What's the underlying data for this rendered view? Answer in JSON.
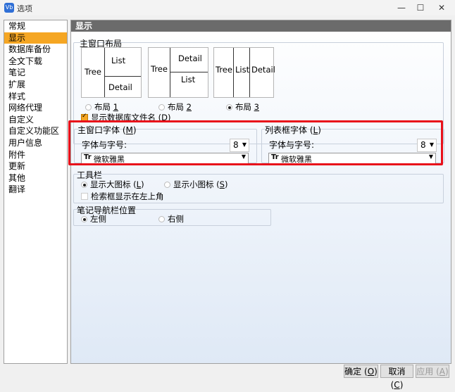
{
  "window": {
    "title": "选项",
    "app_icon": "Vb",
    "minimize": "—",
    "maximize": "☐",
    "close": "✕"
  },
  "sidebar": {
    "items": [
      "常规",
      "显示",
      "数据库备份",
      "全文下载",
      "笔记",
      "扩展",
      "样式",
      "网络代理",
      "自定义",
      "自定义功能区",
      "用户信息",
      "附件",
      "更新",
      "其他",
      "翻译"
    ],
    "selected_index": 1
  },
  "panel": {
    "title": "显示",
    "main_layout": {
      "title": "主窗口布局",
      "layouts": [
        {
          "cells": [
            "Tree",
            "List",
            "Detail"
          ],
          "option_label": "布局",
          "number": "1",
          "selected": false
        },
        {
          "cells": [
            "Tree",
            "Detail",
            "List"
          ],
          "option_label": "布局",
          "number": "2",
          "selected": false
        },
        {
          "cells": [
            "Tree",
            "List",
            "Detail"
          ],
          "option_label": "布局",
          "number": "3",
          "selected": true
        }
      ],
      "show_db_filename": {
        "label": "显示数据库文件名",
        "key": "D",
        "checked": true
      }
    },
    "main_font": {
      "title": "主窗口字体",
      "key": "M",
      "font_size_label": "字体与字号:",
      "size": "8",
      "font": "微软雅黑",
      "font_icon": "Tr"
    },
    "list_font": {
      "title": "列表框字体",
      "key": "L",
      "font_size_label": "字体与字号:",
      "size": "8",
      "font": "微软雅黑",
      "font_icon": "Tr"
    },
    "toolbar": {
      "title": "工具栏",
      "large_icons": {
        "label": "显示大图标",
        "key": "L",
        "selected": true
      },
      "small_icons": {
        "label": "显示小图标",
        "key": "S",
        "selected": false
      },
      "search_top_left": {
        "label": "检索框显示在左上角",
        "checked": false
      }
    },
    "note_nav": {
      "title": "笔记导航栏位置",
      "left": {
        "label": "左侧",
        "selected": true
      },
      "right": {
        "label": "右侧",
        "selected": false
      }
    }
  },
  "buttons": {
    "ok": {
      "label": "确定",
      "key": "O"
    },
    "cancel": {
      "label": "取消",
      "key": "C"
    },
    "apply": {
      "label": "应用",
      "key": "A"
    }
  },
  "colors": {
    "accent": "#f5a623",
    "highlight": "#e8101a",
    "header": "#6b6b6b"
  }
}
